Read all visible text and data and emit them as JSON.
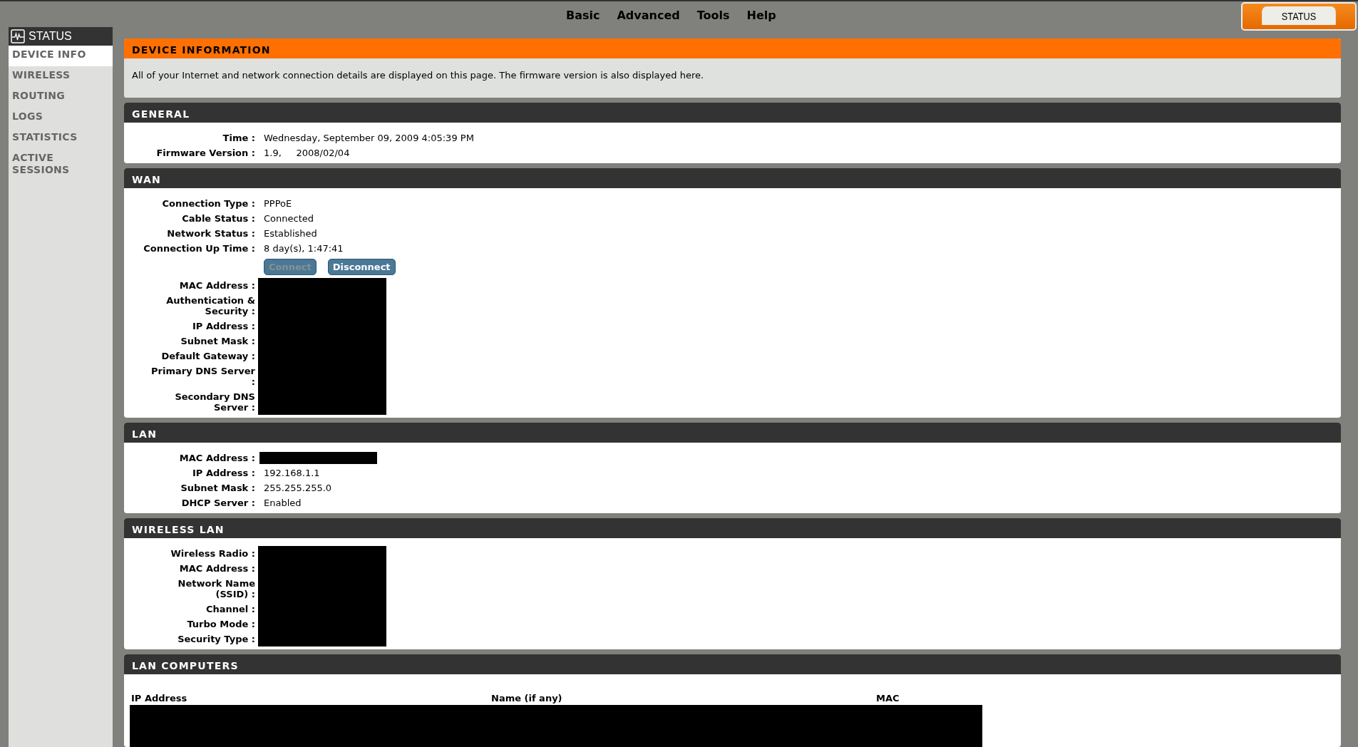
{
  "top_nav": [
    {
      "label": "Basic"
    },
    {
      "label": "Advanced"
    },
    {
      "label": "Tools"
    },
    {
      "label": "Help"
    }
  ],
  "status_tab": {
    "label": "STATUS"
  },
  "sidebar": {
    "title": "STATUS",
    "items": [
      {
        "label": "DEVICE INFO",
        "selected": true
      },
      {
        "label": "WIRELESS",
        "selected": false
      },
      {
        "label": "ROUTING",
        "selected": false
      },
      {
        "label": "LOGS",
        "selected": false
      },
      {
        "label": "STATISTICS",
        "selected": false
      },
      {
        "label": "ACTIVE SESSIONS",
        "selected": false
      }
    ]
  },
  "intro": {
    "title": "DEVICE INFORMATION",
    "text": "All of your Internet and network connection details are displayed on this page. The firmware version is also displayed here."
  },
  "sections": [
    {
      "title": "GENERAL",
      "rows": [
        {
          "kind": "field",
          "label": "Time :",
          "value": "Wednesday, September 09, 2009 4:05:39 PM"
        },
        {
          "kind": "field",
          "label": "Firmware Version :",
          "value": "1.9,     2008/02/04"
        }
      ]
    },
    {
      "title": "WAN",
      "rows": [
        {
          "kind": "field",
          "label": "Connection Type :",
          "value": "PPPoE"
        },
        {
          "kind": "field",
          "label": "Cable Status :",
          "value": "Connected"
        },
        {
          "kind": "field",
          "label": "Network Status :",
          "value": "Established"
        },
        {
          "kind": "field",
          "label": "Connection Up Time :",
          "value": "8 day(s), 1:47:41"
        },
        {
          "kind": "buttons",
          "buttons": [
            {
              "label": "Connect",
              "disabled": true
            },
            {
              "label": "Disconnect",
              "disabled": false
            }
          ]
        },
        {
          "kind": "hidden",
          "label": "MAC Address :"
        },
        {
          "kind": "hidden",
          "label": "Authentication & Security :"
        },
        {
          "kind": "hidden",
          "label": "IP Address :"
        },
        {
          "kind": "hidden",
          "label": "Subnet Mask :"
        },
        {
          "kind": "hidden",
          "label": "Default Gateway :"
        },
        {
          "kind": "hidden",
          "label": "Primary DNS Server :"
        },
        {
          "kind": "hidden",
          "label": "Secondary DNS Server :"
        }
      ]
    },
    {
      "title": "LAN",
      "rows": [
        {
          "kind": "hidden",
          "label": "MAC Address :"
        },
        {
          "kind": "field",
          "label": "IP Address :",
          "value": "192.168.1.1"
        },
        {
          "kind": "field",
          "label": "Subnet Mask :",
          "value": "255.255.255.0"
        },
        {
          "kind": "field",
          "label": "DHCP Server :",
          "value": "Enabled"
        }
      ]
    },
    {
      "title": "WIRELESS LAN",
      "rows": [
        {
          "kind": "hidden",
          "label": "Wireless Radio :"
        },
        {
          "kind": "hidden",
          "label": "MAC Address :"
        },
        {
          "kind": "hidden",
          "label": "Network Name (SSID) :"
        },
        {
          "kind": "hidden",
          "label": "Channel :"
        },
        {
          "kind": "hidden",
          "label": "Turbo Mode :"
        },
        {
          "kind": "hidden",
          "label": "Security Type :"
        }
      ]
    }
  ],
  "lan_computers": {
    "title": "LAN COMPUTERS",
    "columns": [
      "IP Address",
      "Name (if any)",
      "MAC"
    ]
  }
}
